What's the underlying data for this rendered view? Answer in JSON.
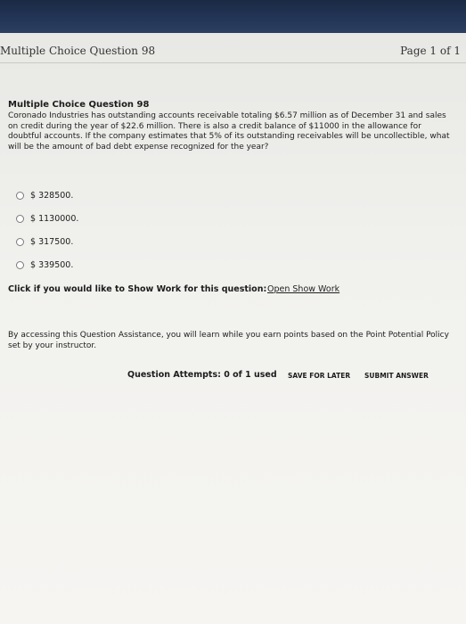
{
  "header": {
    "title": "Multiple Choice Question 98",
    "page_indicator": "Page 1 of 1"
  },
  "question": {
    "title": "Multiple Choice Question 98",
    "text": "Coronado Industries has outstanding accounts receivable totaling $6.57 million as of December 31 and sales on credit during the year of $22.6 million. There is also a credit balance of $11000 in the allowance for doubtful accounts. If the company estimates that 5% of its outstanding receivables will be uncollectible, what will be the amount of bad debt expense recognized for the year?"
  },
  "options": [
    {
      "label": "$ 328500."
    },
    {
      "label": "$ 1130000."
    },
    {
      "label": "$ 317500."
    },
    {
      "label": "$ 339500."
    }
  ],
  "show_work": {
    "prompt": "Click if you would like to Show Work for this question:",
    "link": "Open Show Work"
  },
  "assistance": {
    "text": "By accessing this Question Assistance, you will learn while you earn points based on the Point Potential Policy set by your instructor."
  },
  "footer": {
    "attempts": "Question Attempts: 0 of 1 used",
    "save_label": "SAVE FOR LATER",
    "submit_label": "SUBMIT ANSWER"
  }
}
